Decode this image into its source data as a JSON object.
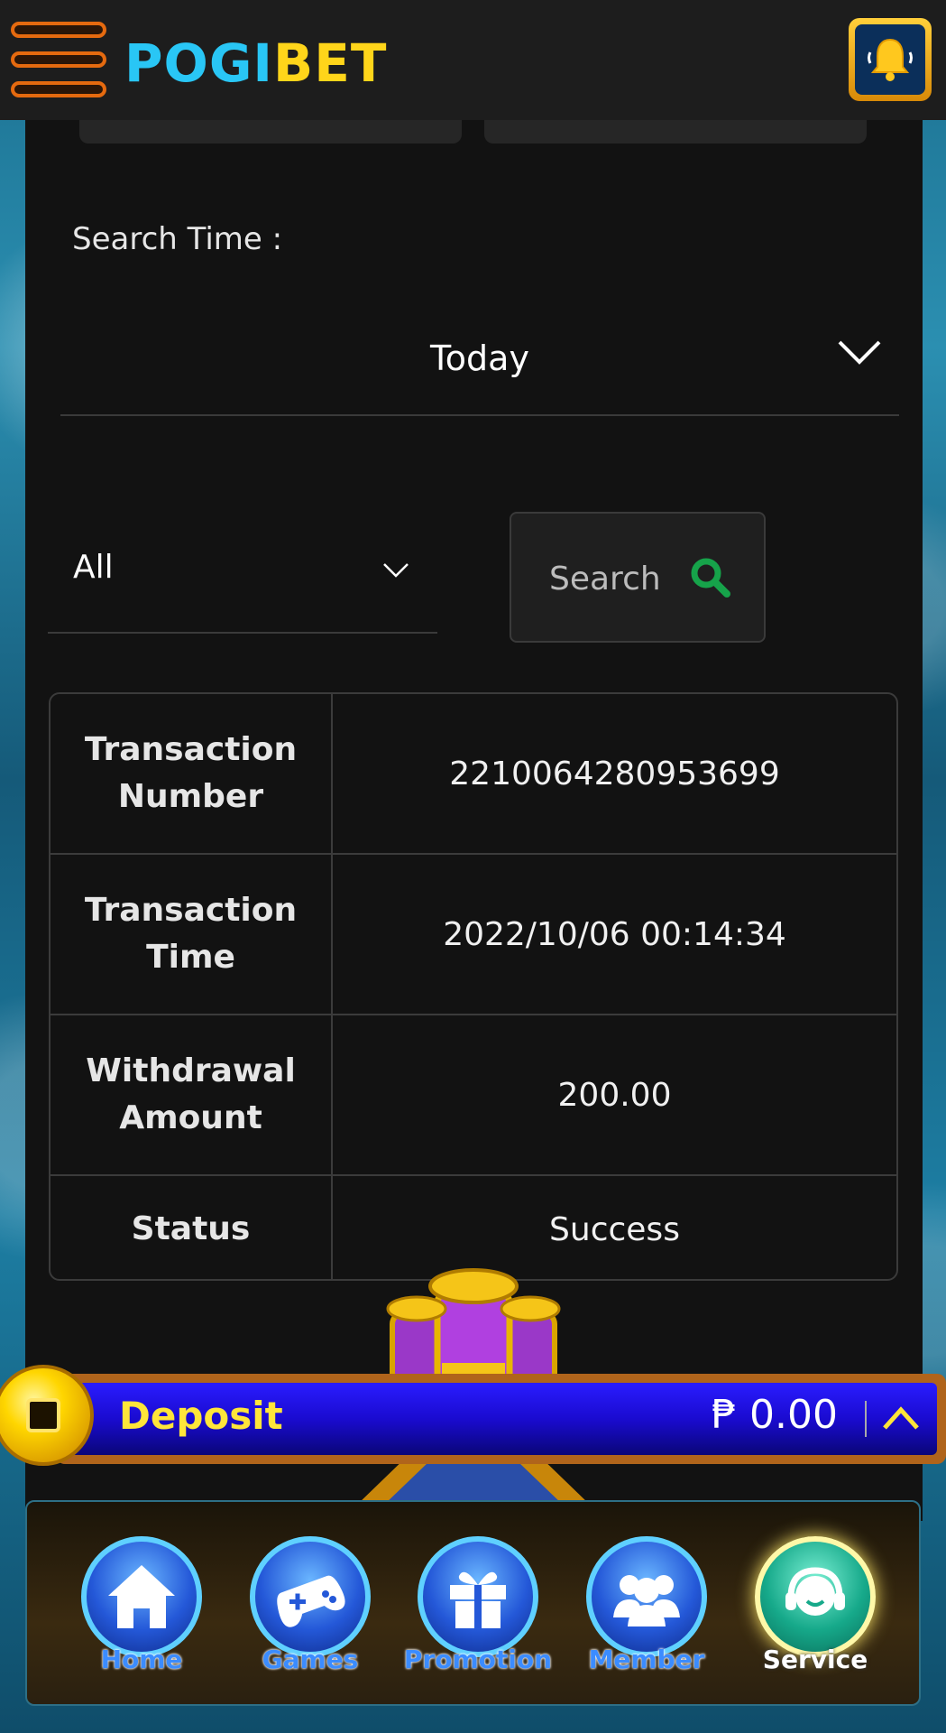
{
  "header": {
    "logo_part1": "POGI",
    "logo_part2": "BET",
    "menu_icon": "hamburger-icon",
    "notification_icon": "bell-icon"
  },
  "filters": {
    "search_time_label": "Search Time :",
    "date_range_value": "Today",
    "type_value": "All",
    "search_button_label": "Search",
    "search_icon": "magnifier-icon"
  },
  "transaction": {
    "rows": [
      {
        "label": "Transaction Number",
        "value": "2210064280953699"
      },
      {
        "label": "Transaction Time",
        "value": "2022/10/06 00:14:34"
      },
      {
        "label": "Withdrawal Amount",
        "value": "200.00"
      },
      {
        "label": "Status",
        "value": "Success"
      }
    ]
  },
  "deposit_bar": {
    "label": "Deposit",
    "balance": "₱ 0.00",
    "toggle_icon": "chevron-up-icon"
  },
  "bottom_nav": {
    "items": [
      {
        "label": "Home",
        "icon": "home-icon"
      },
      {
        "label": "Games",
        "icon": "gamepad-icon"
      },
      {
        "label": "Promotion",
        "icon": "gift-icon"
      },
      {
        "label": "Member",
        "icon": "users-icon"
      },
      {
        "label": "Service",
        "icon": "headset-icon",
        "active": true
      }
    ]
  },
  "colors": {
    "brand_blue": "#29c6f5",
    "brand_yellow": "#ffd51a",
    "accent_orange": "#e56a0f",
    "search_icon_green": "#16a34a",
    "deposit_blue": "#1a0bd0"
  }
}
